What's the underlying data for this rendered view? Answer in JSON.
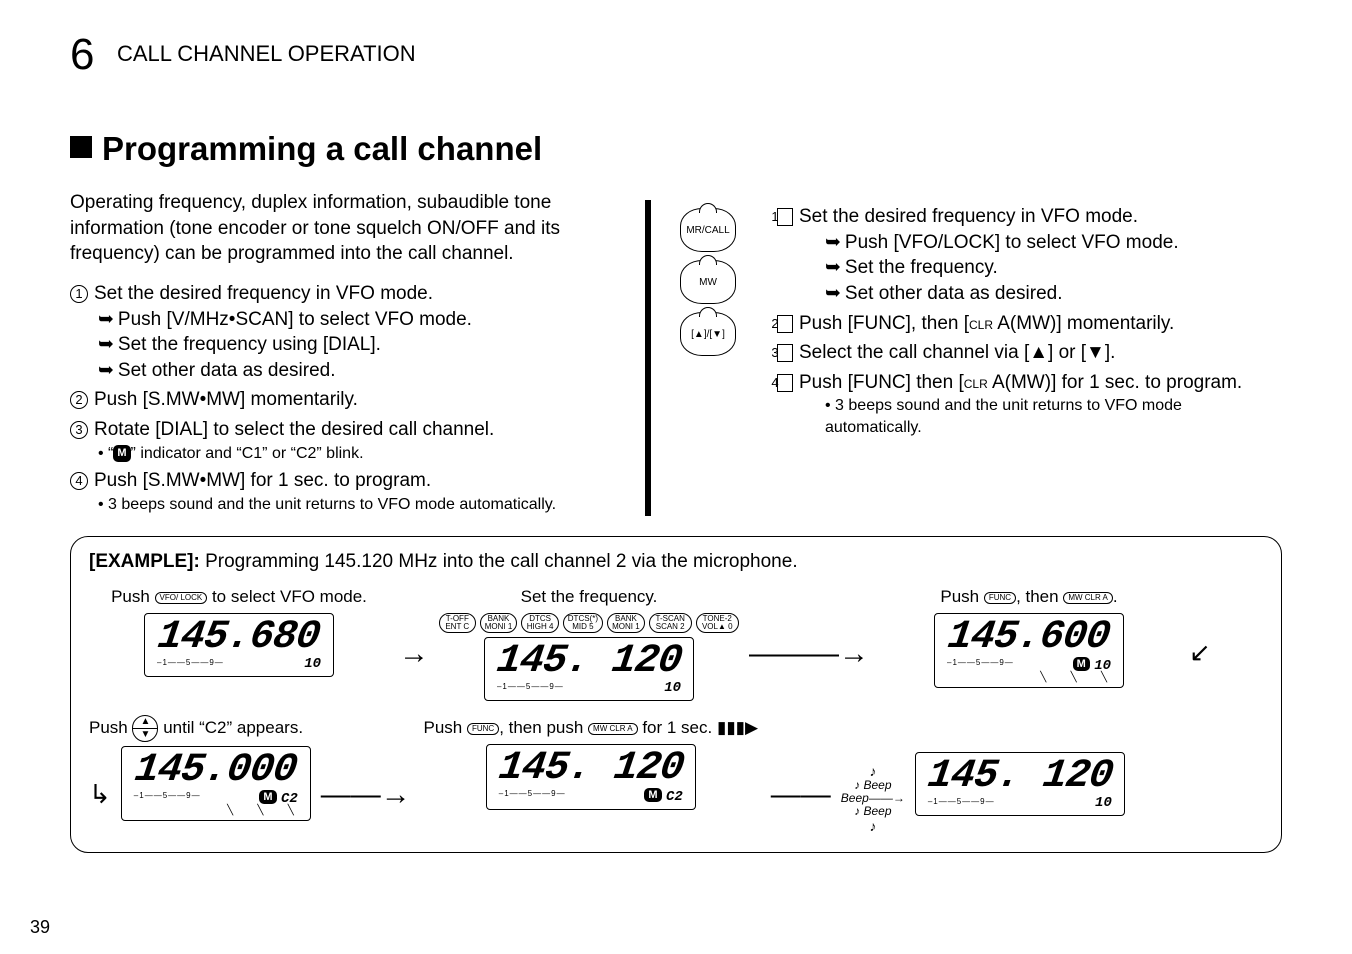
{
  "chapter_number": "6",
  "chapter_title": "CALL CHANNEL OPERATION",
  "heading": "Programming a call channel",
  "intro": "Operating frequency, duplex information, subaudible tone information (tone encoder or tone squelch ON/OFF and its frequency) can be programmed into the call channel.",
  "steps_left": {
    "s1": "Set the desired frequency in VFO mode.",
    "s1a": "Push [V/MHz•SCAN] to select VFO mode.",
    "s1b": "Set the frequency using [DIAL].",
    "s1c": "Set other data as desired.",
    "s2": "Push [S.MW•MW] momentarily.",
    "s3": "Rotate [DIAL] to select the desired call channel.",
    "s3a_pre": "• “",
    "s3a_ind": "M",
    "s3a_post": "” indicator and “C1” or “C2” blink.",
    "s4": "Push [S.MW•MW] for 1 sec. to program.",
    "s4a": "• 3 beeps sound and the unit returns to VFO mode automatically."
  },
  "mic_labels": {
    "b1": "MR/CALL",
    "b2": "MW",
    "b3": "[▲]/[▼]"
  },
  "steps_right": {
    "s1": "Set the desired frequency in VFO mode.",
    "s1a": "Push [VFO/LOCK] to select VFO mode.",
    "s1b": "Set the frequency.",
    "s1c": "Set other data as desired.",
    "s2_pre": "Push [FUNC], then [",
    "s2_sc": "clr",
    "s2_post": " A(MW)] momentarily.",
    "s3": "Select the call channel via [▲] or [▼].",
    "s4_pre": "Push [FUNC] then [",
    "s4_sc": "clr",
    "s4_post": " A(MW)] for 1 sec. to program.",
    "s4a": "• 3 beeps sound and the unit returns to VFO mode automatically."
  },
  "example": {
    "title_label": "[EXAMPLE]:",
    "title_text": " Programming 145.120 MHz into the call channel 2 via the microphone.",
    "step1_pre": "Push ",
    "step1_key": "VFO/\nLOCK",
    "step1_post": " to select VFO mode.",
    "step1_lcd": "145.680",
    "step2_label": "Set the frequency.",
    "keypad": [
      "T-OFF ENT C",
      "BANK MONI 1",
      "DTCS HIGH 4",
      "DTCS(*) MID 5",
      "BANK MONI 1",
      "T-SCAN SCAN 2",
      "TONE-2 VOL▲ 0"
    ],
    "step2_lcd": "145. 120",
    "step3_pre": "Push ",
    "step3_k1": "FUNC",
    "step3_mid": ", then ",
    "step3_k2": "MW\nCLR A",
    "step3_post": ".",
    "step3_lcd": "145.600",
    "step4_pre": "Push ",
    "step4_post": " until “C2” appears.",
    "step4_lcd": "145.000",
    "step4_ch": "C2",
    "step5_pre": "Push ",
    "step5_k1": "FUNC",
    "step5_mid": ", then push ",
    "step5_k2": "MW\nCLR A",
    "step5_post": " for 1 sec. ",
    "step5_lcd": "145. 120",
    "step5_ch": "C2",
    "beep": "Beep",
    "step6_lcd": "145. 120",
    "sig": "–1——5——9—",
    "ten": "10"
  },
  "page_number": "39"
}
